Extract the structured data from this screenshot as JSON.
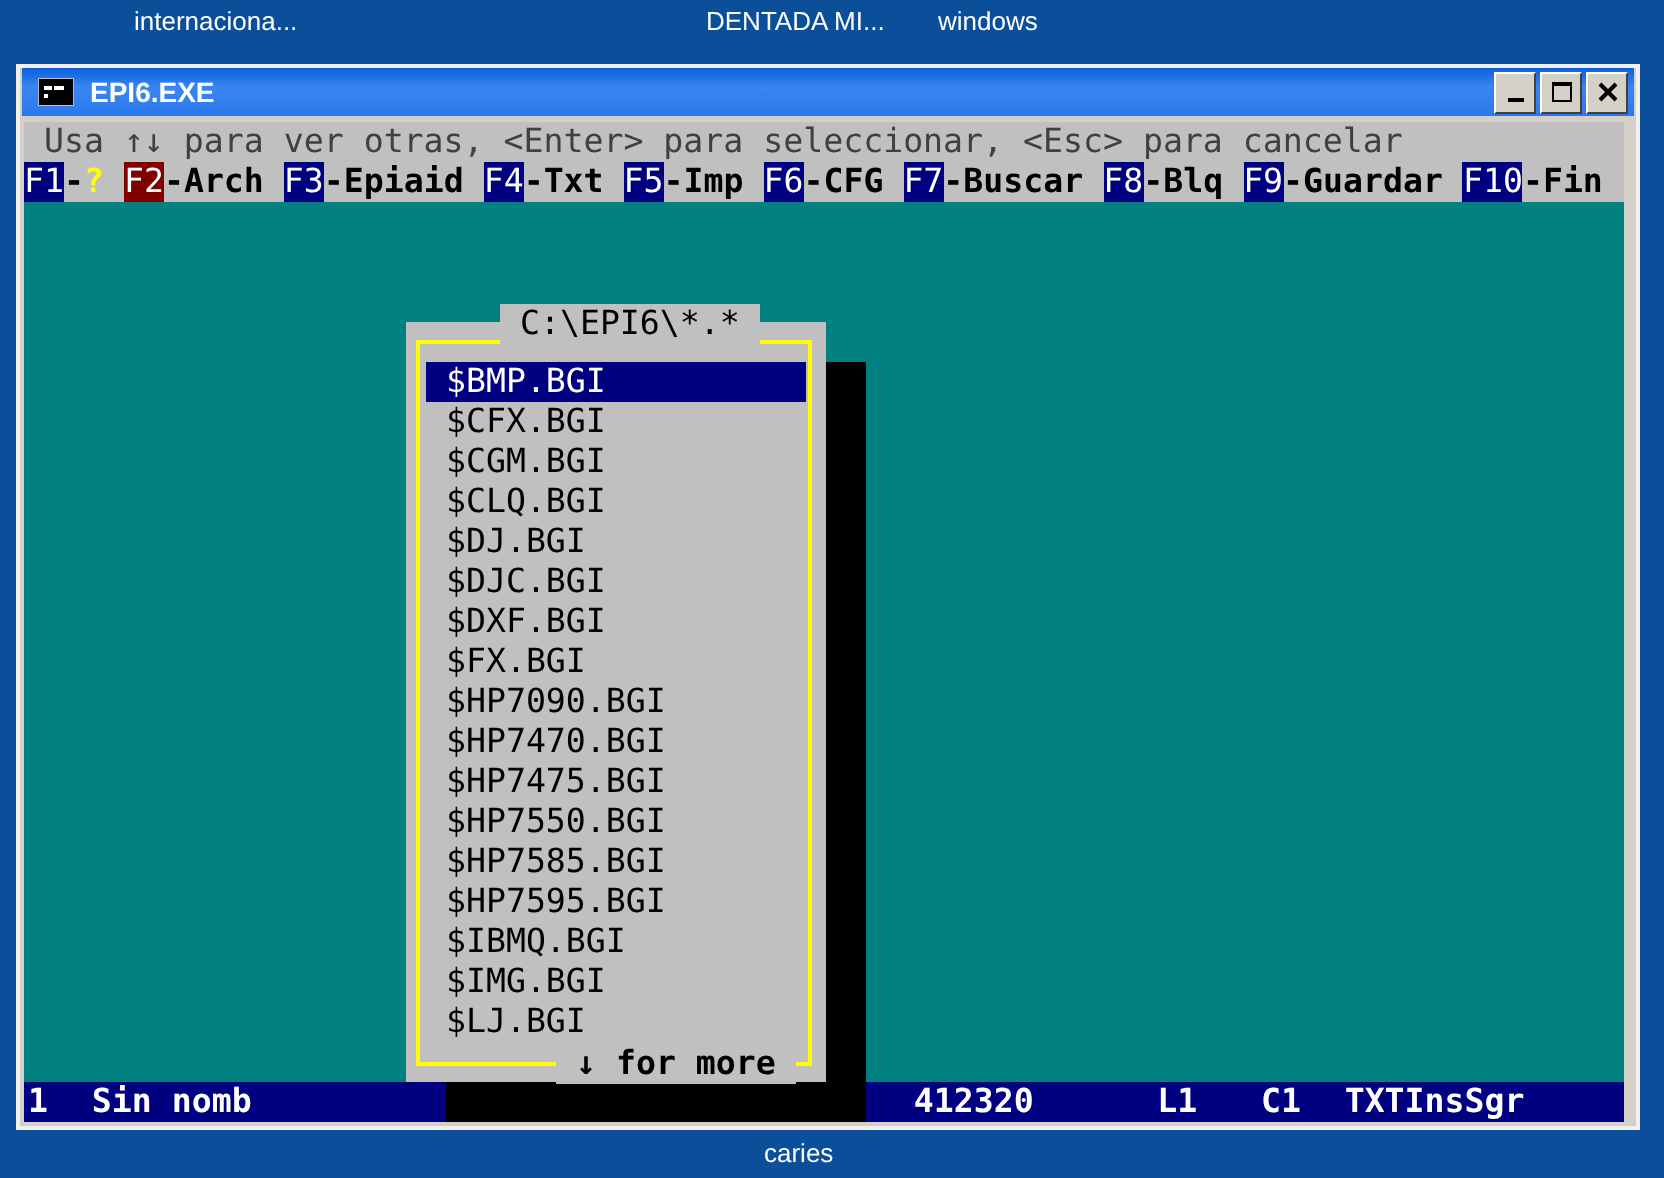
{
  "desktop": {
    "icon_labels": [
      "internaciona...",
      "DENTADA MI...",
      "windows"
    ],
    "bottom_label": "caries"
  },
  "window": {
    "title": "EPI6.EXE"
  },
  "hint": "Usa ↑↓ para ver otras, <Enter> para seleccionar, <Esc> para cancelar",
  "function_keys": [
    {
      "key": "F1",
      "separator": "-",
      "label": "?",
      "kind": "help",
      "active": false
    },
    {
      "key": "F2",
      "separator": "-",
      "label": "Arch",
      "kind": "command",
      "active": true
    },
    {
      "key": "F3",
      "separator": "-",
      "label": "Epiaid",
      "kind": "command",
      "active": false
    },
    {
      "key": "F4",
      "separator": "-",
      "label": "Txt",
      "kind": "command",
      "active": false
    },
    {
      "key": "F5",
      "separator": "-",
      "label": "Imp",
      "kind": "command",
      "active": false
    },
    {
      "key": "F6",
      "separator": "-",
      "label": "CFG",
      "kind": "command",
      "active": false
    },
    {
      "key": "F7",
      "separator": "-",
      "label": "Buscar",
      "kind": "command",
      "active": false
    },
    {
      "key": "F8",
      "separator": "-",
      "label": "Blq",
      "kind": "command",
      "active": false
    },
    {
      "key": "F9",
      "separator": "-",
      "label": "Guardar",
      "kind": "command",
      "active": false
    },
    {
      "key": "F10",
      "separator": "-",
      "label": "Fin",
      "kind": "command",
      "active": false
    }
  ],
  "file_dialog": {
    "title": "C:\\EPI6\\*.*",
    "footer": "↓ for more",
    "files": [
      {
        "name": "$BMP.BGI",
        "selected": true
      },
      {
        "name": "$CFX.BGI",
        "selected": false
      },
      {
        "name": "$CGM.BGI",
        "selected": false
      },
      {
        "name": "$CLQ.BGI",
        "selected": false
      },
      {
        "name": "$DJ.BGI",
        "selected": false
      },
      {
        "name": "$DJC.BGI",
        "selected": false
      },
      {
        "name": "$DXF.BGI",
        "selected": false
      },
      {
        "name": "$FX.BGI",
        "selected": false
      },
      {
        "name": "$HP7090.BGI",
        "selected": false
      },
      {
        "name": "$HP7470.BGI",
        "selected": false
      },
      {
        "name": "$HP7475.BGI",
        "selected": false
      },
      {
        "name": "$HP7550.BGI",
        "selected": false
      },
      {
        "name": "$HP7585.BGI",
        "selected": false
      },
      {
        "name": "$HP7595.BGI",
        "selected": false
      },
      {
        "name": "$IBMQ.BGI",
        "selected": false
      },
      {
        "name": "$IMG.BGI",
        "selected": false
      },
      {
        "name": "$LJ.BGI",
        "selected": false
      }
    ]
  },
  "status_bar": {
    "line": "1",
    "file": "Sin nomb",
    "size": "412320",
    "row": "L1",
    "column": "C1",
    "mode": "TXTInsSgr"
  }
}
